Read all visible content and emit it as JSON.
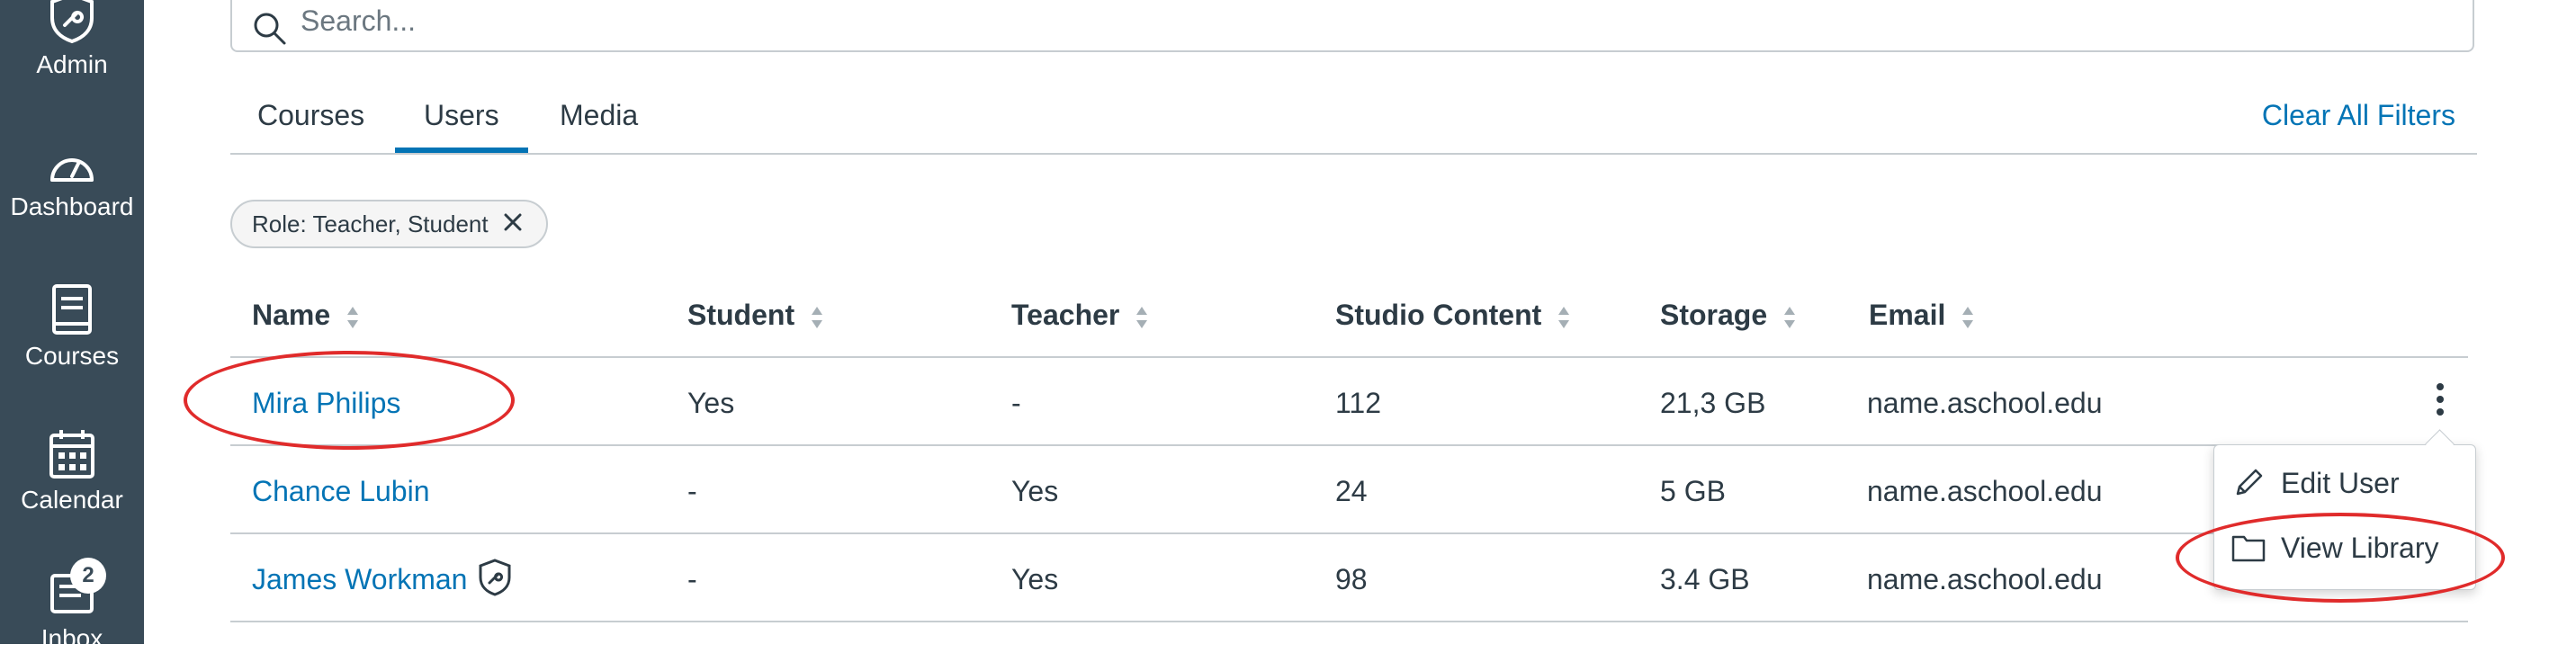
{
  "nav": {
    "admin_label": "Admin",
    "dashboard_label": "Dashboard",
    "courses_label": "Courses",
    "calendar_label": "Calendar",
    "inbox_label": "Inbox",
    "inbox_badge": "2"
  },
  "search": {
    "placeholder": "Search..."
  },
  "tabs": [
    {
      "label": "Courses",
      "active": false
    },
    {
      "label": "Users",
      "active": true
    },
    {
      "label": "Media",
      "active": false
    }
  ],
  "clear_filters_label": "Clear All Filters",
  "filter_pill": {
    "label": "Role: Teacher, Student"
  },
  "table": {
    "headers": [
      "Name",
      "Student",
      "Teacher",
      "Studio Content",
      "Storage",
      "Email"
    ],
    "rows": [
      {
        "name": "Mira Philips",
        "student": "Yes",
        "teacher": "-",
        "studio_content": "112",
        "storage": "21,3 GB",
        "email": "name.aschool.edu"
      },
      {
        "name": "Chance Lubin",
        "student": "-",
        "teacher": "Yes",
        "studio_content": "24",
        "storage": "5 GB",
        "email": "name.aschool.edu"
      },
      {
        "name": "James Workman",
        "student": "-",
        "teacher": "Yes",
        "studio_content": "98",
        "storage": "3.4 GB",
        "email": "name.aschool.edu",
        "admin_icon": "admin-shield-icon"
      }
    ]
  },
  "row_menu": {
    "items": [
      "Edit User",
      "View Library"
    ]
  },
  "colors": {
    "nav_bg": "#394b58",
    "link": "#0374b5",
    "text": "#2d3b45",
    "border": "#c7cdd1",
    "annotation": "#e02b2b"
  }
}
